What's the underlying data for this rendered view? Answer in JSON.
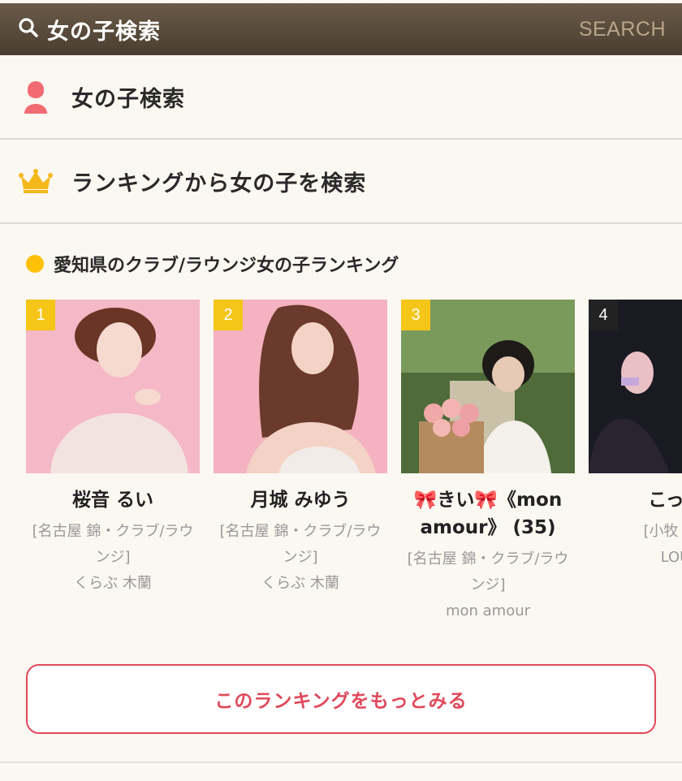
{
  "header": {
    "title": "女の子検索",
    "search_label": "SEARCH"
  },
  "menu": [
    {
      "label": "女の子検索",
      "icon": "person-icon"
    },
    {
      "label": "ランキングから女の子を検索",
      "icon": "crown-icon"
    }
  ],
  "ranking": {
    "title": "愛知県のクラブ/ラウンジ女の子ランキング",
    "cards": [
      {
        "rank": "1",
        "name": "桜音 るい",
        "area": "[名古屋 錦・クラブ/ラウンジ]",
        "shop": "くらぶ 木蘭"
      },
      {
        "rank": "2",
        "name": "月城 みゆう",
        "area": "[名古屋 錦・クラブ/ラウンジ]",
        "shop": "くらぶ 木蘭"
      },
      {
        "rank": "3",
        "name": "🎀きい🎀《mon amour》 (35)",
        "area": "[名古屋 錦・クラブ/ラウンジ]",
        "shop": "mon amour"
      },
      {
        "rank": "4",
        "name": "こっ…",
        "area": "[小牧・ク",
        "shop": "LOU"
      }
    ],
    "more_button": "このランキングをもっとみる"
  },
  "colors": {
    "accent": "#e0495b",
    "rank_badge": "#f5c518",
    "header_bg": "#5a4c3c"
  }
}
